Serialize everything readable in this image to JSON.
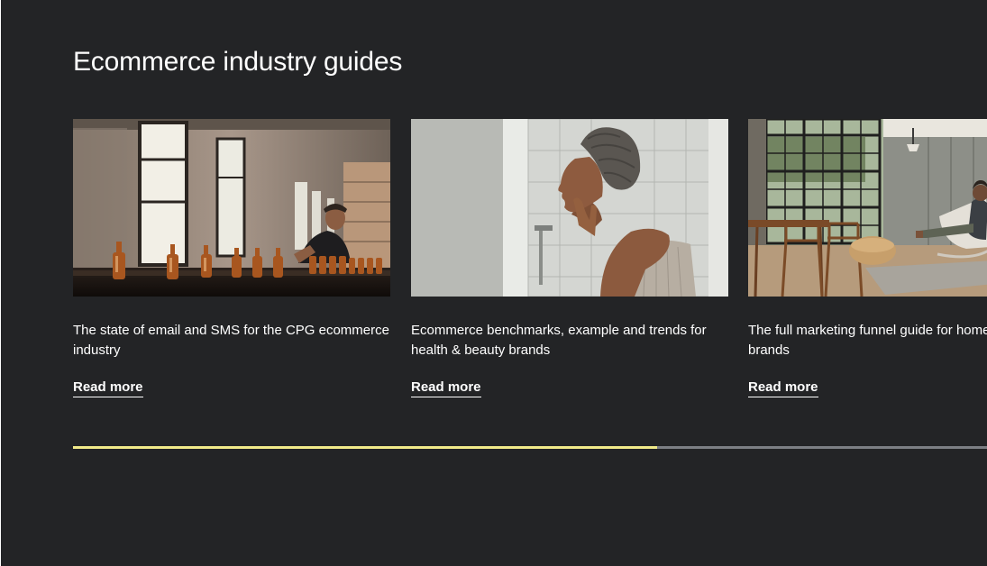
{
  "section": {
    "title": "Ecommerce industry guides"
  },
  "guides": [
    {
      "title": "The state of email and SMS for the CPG ecommerce industry",
      "link_label": "Read more",
      "image_alt": "Worker inspecting amber bottles on a production line"
    },
    {
      "title": "Ecommerce benchmarks, example and trends for health & beauty brands",
      "link_label": "Read more",
      "image_alt": "Woman with towel on head checking her skin in a mirror"
    },
    {
      "title": "The full marketing funnel guide for home brands",
      "link_label": "Read more",
      "image_alt": "Person sitting in a rocking chair in a bright living room"
    }
  ],
  "carousel": {
    "progress_fraction": 0.635
  },
  "colors": {
    "background": "#232426",
    "text": "#ffffff",
    "progress_fill": "#f1ea8a",
    "progress_track": "#7c7f84"
  }
}
